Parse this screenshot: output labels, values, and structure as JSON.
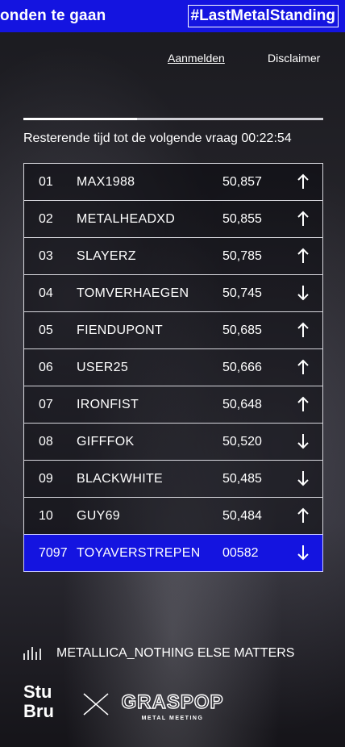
{
  "topbar": {
    "marquee_text": "onden te gaan",
    "hashtag": "#LastMetalStanding"
  },
  "nav": {
    "login": "Aanmelden",
    "disclaimer": "Disclaimer"
  },
  "progress": {
    "fraction": 0.38
  },
  "timer": {
    "text": "Resterende tijd tot de volgende vraag 00:22:54"
  },
  "leaderboard": [
    {
      "rank": "01",
      "name": "MAX1988",
      "score": "50,857",
      "trend": "up"
    },
    {
      "rank": "02",
      "name": "METALHEADXD",
      "score": "50,855",
      "trend": "up"
    },
    {
      "rank": "03",
      "name": "SLAYERZ",
      "score": "50,785",
      "trend": "up"
    },
    {
      "rank": "04",
      "name": "TOMVERHAEGEN",
      "score": "50,745",
      "trend": "down"
    },
    {
      "rank": "05",
      "name": "FIENDUPONT",
      "score": "50,685",
      "trend": "up"
    },
    {
      "rank": "06",
      "name": "USER25",
      "score": "50,666",
      "trend": "up"
    },
    {
      "rank": "07",
      "name": "IRONFIST",
      "score": "50,648",
      "trend": "up"
    },
    {
      "rank": "08",
      "name": "GIFFFOK",
      "score": "50,520",
      "trend": "down"
    },
    {
      "rank": "09",
      "name": "BLACKWHITE",
      "score": "50,485",
      "trend": "down"
    },
    {
      "rank": "10",
      "name": "GUY69",
      "score": "50,484",
      "trend": "up"
    }
  ],
  "current_user": {
    "rank": "7097",
    "name": "TOYAVERSTREPEN",
    "score": "00582",
    "trend": "down"
  },
  "now_playing": {
    "title": "METALLICA_NOTHING ELSE MATTERS"
  },
  "logos": {
    "stubru_line1": "Stu",
    "stubru_line2": "Bru",
    "graspop_main": "GRASPOP",
    "graspop_sub": "METAL MEETING"
  },
  "colors": {
    "accent": "#1414e0",
    "text": "#ffffff"
  },
  "icons": {
    "up": "arrow-up-icon",
    "down": "arrow-down-icon"
  }
}
